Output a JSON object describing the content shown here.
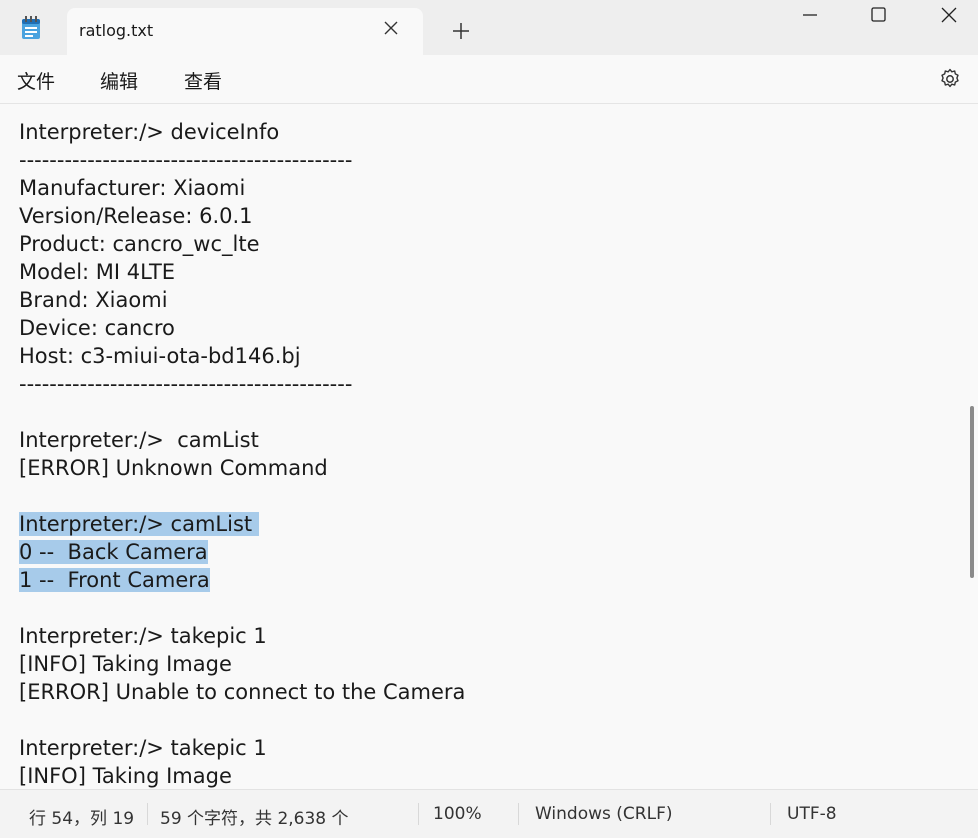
{
  "window": {
    "tab_title": "ratlog.txt"
  },
  "menu": {
    "file": "文件",
    "edit": "编辑",
    "view": "查看"
  },
  "icons": {
    "app": "notepad-icon",
    "tab_close": "close-icon",
    "new_tab": "plus-icon",
    "minimize": "minimize-icon",
    "maximize": "maximize-icon",
    "close": "close-icon",
    "settings": "gear-icon"
  },
  "editor": {
    "lines": [
      "Interpreter:/> deviceInfo",
      "--------------------------------------------",
      "Manufacturer: Xiaomi",
      "Version/Release: 6.0.1",
      "Product: cancro_wc_lte",
      "Model: MI 4LTE",
      "Brand: Xiaomi",
      "Device: cancro",
      "Host: c3-miui-ota-bd146.bj",
      "--------------------------------------------",
      "",
      "Interpreter:/>  camList",
      "[ERROR] Unknown Command",
      "",
      "Interpreter:/> camList ",
      "0 --  Back Camera",
      "1 --  Front Camera",
      "",
      "Interpreter:/> takepic 1",
      "[INFO] Taking Image",
      "[ERROR] Unable to connect to the Camera",
      "",
      "Interpreter:/> takepic 1",
      "[INFO] Taking Image"
    ],
    "highlight_color": "#a7cbea"
  },
  "status": {
    "position": "行 54，列 19",
    "char_count": "59 个字符，共 2,638 个",
    "zoom": "100%",
    "line_ending": "Windows (CRLF)",
    "encoding": "UTF-8"
  }
}
